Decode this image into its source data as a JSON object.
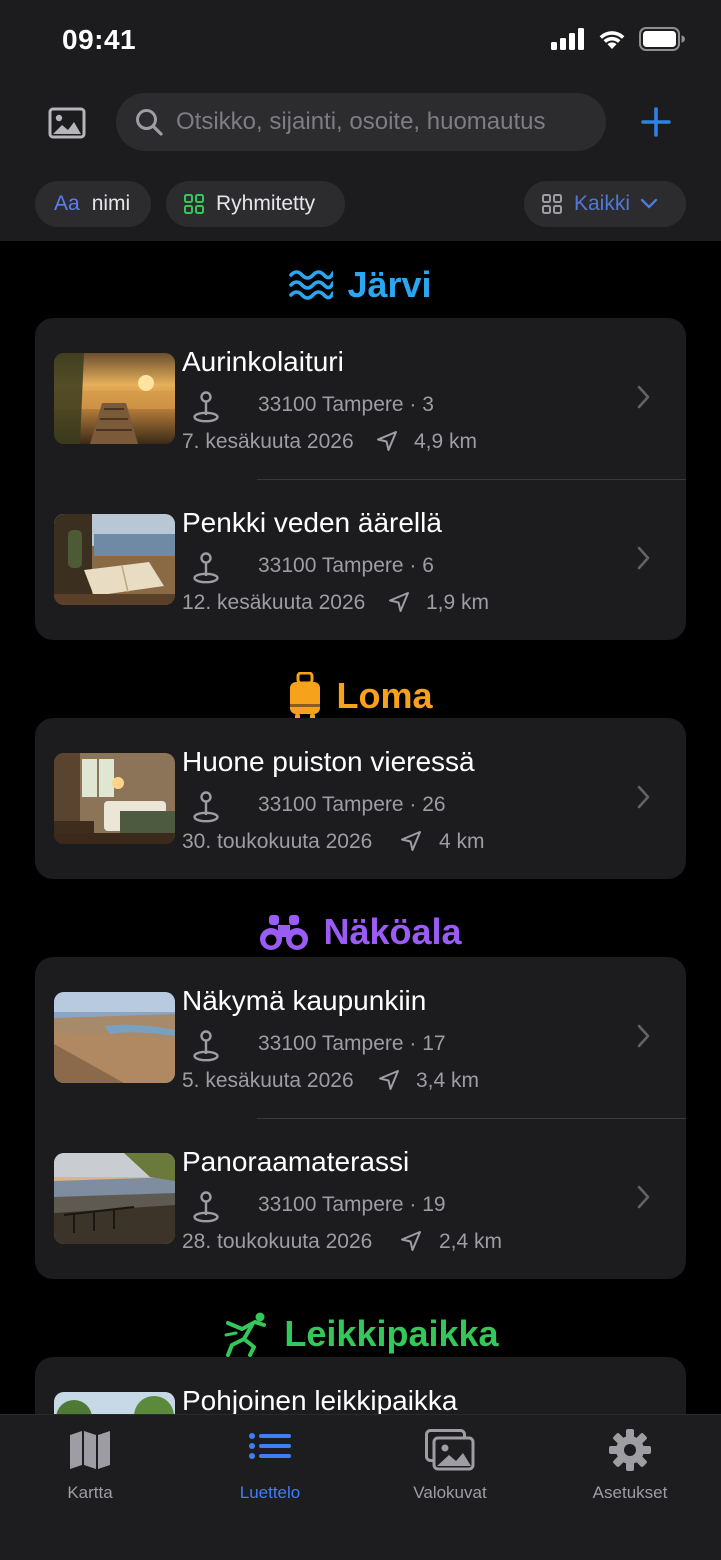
{
  "status_bar": {
    "time": "09:41"
  },
  "header": {
    "search_placeholder": "Otsikko, sijainti, osoite, huomautus",
    "icons": [
      "photo-icon",
      "search-icon",
      "plus-icon"
    ],
    "accent_color": "#2f80ed"
  },
  "filters": {
    "sort": {
      "prefix": "Aa",
      "label": "nimi"
    },
    "group": {
      "label": "Ryhmitetty"
    },
    "filter": {
      "label": "Kaikki"
    }
  },
  "sections": [
    {
      "title": "Järvi",
      "color": "#2aa7f0",
      "icon": "water-waves-icon",
      "items": [
        {
          "title": "Aurinkolaituri",
          "address": "33100 Tampere · 3",
          "date": "7. kesäkuuta 2026",
          "distance": "4,9 km",
          "image": "sunset-pier-photo"
        },
        {
          "title": "Penkki veden äärellä",
          "address": "33100 Tampere · 6",
          "date": "12. kesäkuuta 2026",
          "distance": "1,9 km",
          "image": "bench-by-water-photo"
        }
      ]
    },
    {
      "title": "Loma",
      "color": "#f7a21b",
      "icon": "suitcase-icon",
      "items": [
        {
          "title": "Huone puiston vieressä",
          "address": "33100 Tampere · 26",
          "date": "30. toukokuuta 2026",
          "distance": "4 km",
          "image": "hotel-room-photo"
        }
      ]
    },
    {
      "title": "Näköala",
      "color": "#9b5cf6",
      "icon": "binoculars-icon",
      "items": [
        {
          "title": "Näkymä kaupunkiin",
          "address": "33100 Tampere · 17",
          "date": "5. kesäkuuta 2026",
          "distance": "3,4 km",
          "image": "city-view-photo"
        },
        {
          "title": "Panoraamaterassi",
          "address": "33100 Tampere · 19",
          "date": "28. toukokuuta 2026",
          "distance": "2,4 km",
          "image": "panorama-terrace-photo"
        }
      ]
    },
    {
      "title": "Leikkipaikka",
      "color": "#34c759",
      "icon": "figure-play-icon",
      "items": [
        {
          "title": "Pohjoinen leikkipaikka",
          "image": "playground-photo"
        }
      ]
    }
  ],
  "tabs": [
    {
      "label": "Kartta",
      "icon": "map-icon",
      "active": false
    },
    {
      "label": "Luettelo",
      "icon": "list-icon",
      "active": true
    },
    {
      "label": "Valokuvat",
      "icon": "photos-icon",
      "active": false
    },
    {
      "label": "Asetukset",
      "icon": "gear-icon",
      "active": false
    }
  ]
}
